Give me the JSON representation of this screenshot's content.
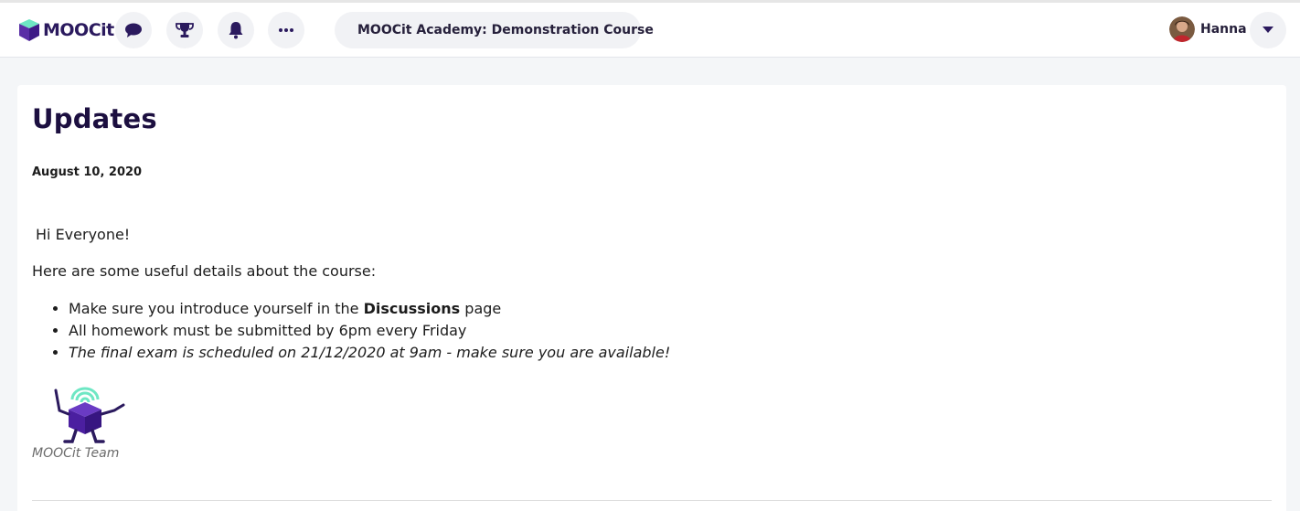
{
  "brand": {
    "name": "MOOCit",
    "accent": "#5a2ea6",
    "accent_light": "#6ee7c4",
    "title_color": "#1c0f40"
  },
  "header": {
    "icons": [
      "chat-icon",
      "trophy-icon",
      "bell-icon",
      "more-icon"
    ],
    "course_menu_icon": "grid-icon",
    "course_title": "MOOCit Academy: Demonstration Course",
    "user": {
      "name": "Hanna",
      "menu_icon": "chevron-down-icon"
    }
  },
  "main": {
    "title": "Updates",
    "update": {
      "date": "August 10, 2020",
      "greeting": "Hi Everyone!",
      "intro": "Here are some useful details about the course:",
      "bullets": [
        {
          "before": "Make sure you introduce yourself in the ",
          "bold": "Discussions",
          "after": " page"
        },
        {
          "text": "All homework must be submitted by 6pm every Friday"
        },
        {
          "text": "The final exam is scheduled on 21/12/2020 at 9am - make sure you are available!"
        }
      ],
      "signature": "MOOCit Team"
    }
  }
}
